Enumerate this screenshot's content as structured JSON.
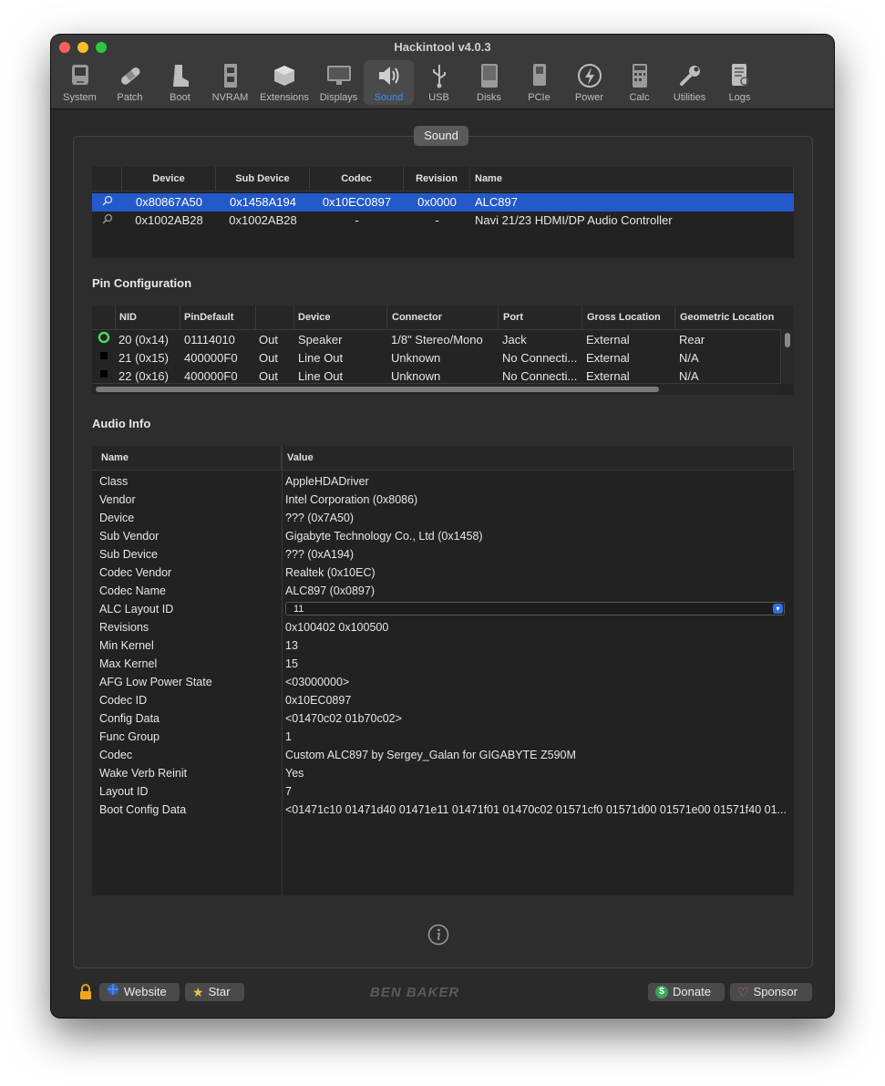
{
  "window": {
    "title": "Hackintool v4.0.3"
  },
  "toolbar": {
    "items": [
      {
        "label": "System",
        "icon": "mac-icon"
      },
      {
        "label": "Patch",
        "icon": "bandage-icon"
      },
      {
        "label": "Boot",
        "icon": "boot-icon"
      },
      {
        "label": "NVRAM",
        "icon": "memory-icon"
      },
      {
        "label": "Extensions",
        "icon": "cube-icon"
      },
      {
        "label": "Displays",
        "icon": "display-icon"
      },
      {
        "label": "Sound",
        "icon": "speaker-icon"
      },
      {
        "label": "USB",
        "icon": "usb-icon"
      },
      {
        "label": "Disks",
        "icon": "disk-icon"
      },
      {
        "label": "PCIe",
        "icon": "card-icon"
      },
      {
        "label": "Power",
        "icon": "bolt-icon"
      },
      {
        "label": "Calc",
        "icon": "calculator-icon"
      },
      {
        "label": "Utilities",
        "icon": "wrench-icon"
      },
      {
        "label": "Logs",
        "icon": "log-icon"
      }
    ],
    "active": "Sound"
  },
  "panel": {
    "tab_label": "Sound"
  },
  "devices": {
    "headers": [
      "Device",
      "Sub Device",
      "Codec",
      "Revision",
      "Name"
    ],
    "rows": [
      {
        "device": "0x80867A50",
        "sub_device": "0x1458A194",
        "codec": "0x10EC0897",
        "revision": "0x0000",
        "name": "ALC897"
      },
      {
        "device": "0x1002AB28",
        "sub_device": "0x1002AB28",
        "codec": "-",
        "revision": "-",
        "name": "Navi 21/23 HDMI/DP Audio Controller"
      }
    ]
  },
  "pin_config": {
    "title": "Pin Configuration",
    "headers": [
      "NID",
      "PinDefault",
      "",
      "Device",
      "Connector",
      "Port",
      "Gross Location",
      "Geometric Location"
    ],
    "rows": [
      {
        "nid": "20 (0x14)",
        "pin_default": "01114010",
        "dir": "Out",
        "device": "Speaker",
        "connector": "1/8\" Stereo/Mono",
        "port": "Jack",
        "gross": "External",
        "geo": "Rear"
      },
      {
        "nid": "21 (0x15)",
        "pin_default": "400000F0",
        "dir": "Out",
        "device": "Line Out",
        "connector": "Unknown",
        "port": "No Connecti...",
        "gross": "External",
        "geo": "N/A"
      },
      {
        "nid": "22 (0x16)",
        "pin_default": "400000F0",
        "dir": "Out",
        "device": "Line Out",
        "connector": "Unknown",
        "port": "No Connecti...",
        "gross": "External",
        "geo": "N/A"
      }
    ]
  },
  "audio_info": {
    "title": "Audio Info",
    "headers": [
      "Name",
      "Value"
    ],
    "rows": [
      {
        "k": "Class",
        "v": "AppleHDADriver"
      },
      {
        "k": "Vendor",
        "v": "Intel Corporation (0x8086)"
      },
      {
        "k": "Device",
        "v": "??? (0x7A50)"
      },
      {
        "k": "Sub Vendor",
        "v": "Gigabyte Technology Co., Ltd (0x1458)"
      },
      {
        "k": "Sub Device",
        "v": "??? (0xA194)"
      },
      {
        "k": "Codec Vendor",
        "v": "Realtek (0x10EC)"
      },
      {
        "k": "Codec Name",
        "v": "ALC897 (0x0897)"
      },
      {
        "k": "ALC Layout ID",
        "v": "11"
      },
      {
        "k": "Revisions",
        "v": "0x100402 0x100500"
      },
      {
        "k": "Min Kernel",
        "v": "13"
      },
      {
        "k": "Max Kernel",
        "v": "15"
      },
      {
        "k": "AFG Low Power State",
        "v": "<03000000>"
      },
      {
        "k": "Codec ID",
        "v": "0x10EC0897"
      },
      {
        "k": "Config Data",
        "v": "<01470c02 01b70c02>"
      },
      {
        "k": "Func Group",
        "v": "1"
      },
      {
        "k": "Codec",
        "v": "Custom ALC897 by Sergey_Galan  for GIGABYTE Z590M"
      },
      {
        "k": "Wake Verb Reinit",
        "v": "Yes"
      },
      {
        "k": "Layout ID",
        "v": "7"
      },
      {
        "k": "Boot Config Data",
        "v": "<01471c10 01471d40 01471e11 01471f01 01470c02 01571cf0 01571d00 01571e00 01571f40 01..."
      }
    ]
  },
  "footer": {
    "website": "Website",
    "star": "Star",
    "brand": "BEN BAKER",
    "donate": "Donate",
    "sponsor": "Sponsor"
  }
}
